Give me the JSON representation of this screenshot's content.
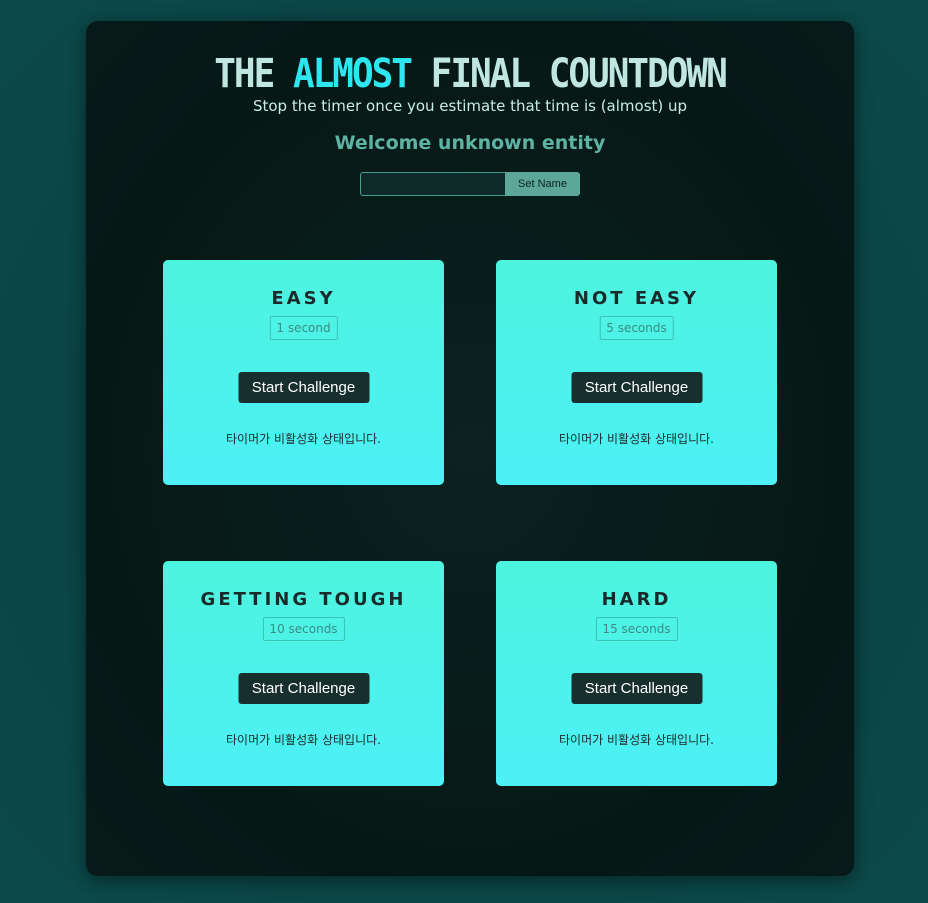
{
  "header": {
    "title_part1": "THE ",
    "title_accent": "ALMOST",
    "title_part2": " FINAL COUNTDOWN",
    "subtitle": "Stop the timer once you estimate that time is (almost) up",
    "welcome": "Welcome unknown entity"
  },
  "name_form": {
    "input_value": "",
    "input_placeholder": "",
    "button_label": "Set Name"
  },
  "challenges": [
    {
      "title": "EASY",
      "time": "1 second",
      "button_label": "Start Challenge",
      "status": "타이머가 비활성화 상태입니다."
    },
    {
      "title": "NOT EASY",
      "time": "5 seconds",
      "button_label": "Start Challenge",
      "status": "타이머가 비활성화 상태입니다."
    },
    {
      "title": "GETTING TOUGH",
      "time": "10 seconds",
      "button_label": "Start Challenge",
      "status": "타이머가 비활성화 상태입니다."
    },
    {
      "title": "HARD",
      "time": "15 seconds",
      "button_label": "Start Challenge",
      "status": "타이머가 비활성화 상태입니다."
    }
  ],
  "colors": {
    "page_bg": "#0b4444",
    "panel_bg": "#061816",
    "title": "#bfe6df",
    "title_accent": "#2ee6f0",
    "welcome": "#5fb3a3",
    "card_top": "#4df4de",
    "card_bottom": "#4cf0f6",
    "button_bg": "#17302e"
  }
}
